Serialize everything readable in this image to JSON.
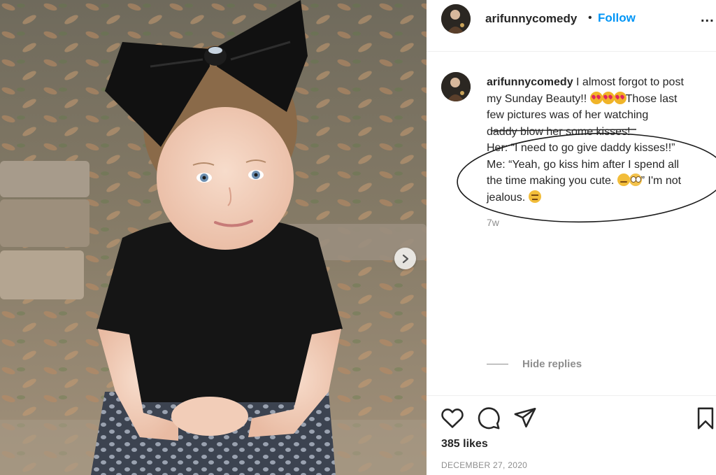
{
  "post": {
    "image_alt": "Photo of a young girl with a large black hair bow and a black top",
    "next_icon": "chevron-right-icon"
  },
  "header": {
    "username": "arifunnycomedy",
    "separator": "•",
    "follow_label": "Follow",
    "more_label": "..."
  },
  "caption": {
    "username": "arifunnycomedy",
    "line1": " I almost forgot to post",
    "line2_a": "my Sunday Beauty!! ",
    "line2_b": "Those last",
    "line3": "few pictures was of her watching",
    "line4": "daddy blow her some kisses!",
    "line5": "Her: “I need to go give daddy kisses!!”",
    "line6": "Me: “Yeah, go kiss him after I spend all",
    "line7_a": "the time making you cute. ",
    "line7_b": "” I'm not",
    "line8": "jealous. "
  },
  "timestamp": "7w",
  "hide_replies_label": "Hide replies",
  "likes": "385 likes",
  "date": "DECEMBER 27, 2020",
  "colors": {
    "follow": "#0095f6",
    "muted": "#8e8e8e",
    "text": "#262626"
  }
}
